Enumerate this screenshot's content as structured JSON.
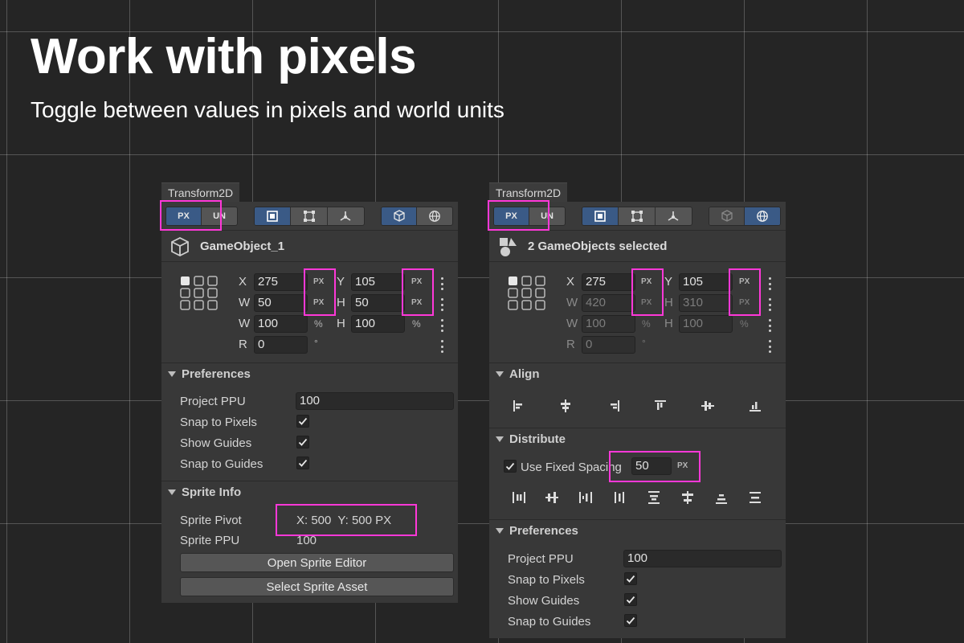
{
  "header": {
    "title": "Work with pixels",
    "subtitle": "Toggle between values in pixels and world units"
  },
  "left_panel": {
    "tab": "Transform2D",
    "unit_toggle": {
      "px": "PX",
      "un": "UN",
      "selected": "PX"
    },
    "object_name": "GameObject_1",
    "transform": {
      "x_label": "X",
      "x_value": "275",
      "x_unit": "PX",
      "y_label": "Y",
      "y_value": "105",
      "y_unit": "PX",
      "w_label": "W",
      "w_value": "50",
      "w_unit": "PX",
      "h_label": "H",
      "h_value": "50",
      "h_unit": "PX",
      "sw_label": "W",
      "sw_value": "100",
      "sw_unit": "%",
      "sh_label": "H",
      "sh_value": "100",
      "sh_unit": "%",
      "r_label": "R",
      "r_value": "0",
      "r_unit": "°"
    },
    "preferences": {
      "title": "Preferences",
      "project_ppu_label": "Project PPU",
      "project_ppu_value": "100",
      "snap_pixels_label": "Snap to Pixels",
      "snap_pixels_checked": true,
      "show_guides_label": "Show Guides",
      "show_guides_checked": true,
      "snap_guides_label": "Snap to Guides",
      "snap_guides_checked": true
    },
    "sprite_info": {
      "title": "Sprite Info",
      "pivot_label": "Sprite Pivot",
      "pivot_value": "X: 500  Y: 500 PX",
      "ppu_label": "Sprite PPU",
      "ppu_value": "100",
      "open_editor": "Open Sprite Editor",
      "select_asset": "Select Sprite Asset"
    }
  },
  "right_panel": {
    "tab": "Transform2D",
    "unit_toggle": {
      "px": "PX",
      "un": "UN",
      "selected": "PX"
    },
    "object_name": "2 GameObjects selected",
    "transform": {
      "x_label": "X",
      "x_value": "275",
      "x_unit": "PX",
      "y_label": "Y",
      "y_value": "105",
      "y_unit": "PX",
      "w_label": "W",
      "w_value": "420",
      "w_unit": "PX",
      "h_label": "H",
      "h_value": "310",
      "h_unit": "PX",
      "sw_label": "W",
      "sw_value": "100",
      "sw_unit": "%",
      "sh_label": "H",
      "sh_value": "100",
      "sh_unit": "%",
      "r_label": "R",
      "r_value": "0",
      "r_unit": "°"
    },
    "align": {
      "title": "Align"
    },
    "distribute": {
      "title": "Distribute",
      "fixed_spacing_label": "Use Fixed Spacing",
      "fixed_spacing_checked": true,
      "fixed_spacing_value": "50",
      "fixed_spacing_unit": "PX"
    },
    "preferences": {
      "title": "Preferences",
      "project_ppu_label": "Project PPU",
      "project_ppu_value": "100",
      "snap_pixels_label": "Snap to Pixels",
      "snap_pixels_checked": true,
      "show_guides_label": "Show Guides",
      "show_guides_checked": true,
      "snap_guides_label": "Snap to Guides",
      "snap_guides_checked": true
    }
  },
  "colors": {
    "background": "#252525",
    "panel": "#383838",
    "accent_selected": "#3a5a86",
    "highlight": "#ff38d8"
  },
  "icons": [
    "cube-icon",
    "shapes-icon",
    "rect-tool-icon",
    "resize-tool-icon",
    "pivot-tool-icon",
    "local-space-icon",
    "world-space-icon",
    "anchor-grid-icon",
    "checkmark-icon",
    "kebab-menu-icon",
    "align-icon",
    "distribute-icon"
  ]
}
